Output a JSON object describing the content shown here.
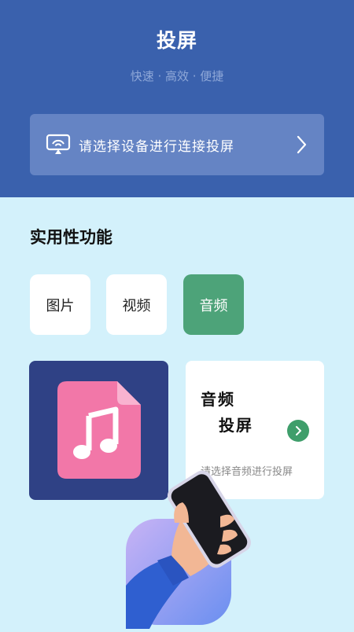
{
  "header": {
    "title": "投屏",
    "subtitle": "快速 · 高效 · 便捷",
    "connect_label": "请选择设备进行连接投屏"
  },
  "features": {
    "section_title": "实用性功能",
    "tabs": [
      {
        "label": "图片",
        "active": false
      },
      {
        "label": "视频",
        "active": false
      },
      {
        "label": "音频",
        "active": true
      }
    ]
  },
  "audio_card": {
    "title_line1": "音频",
    "title_line2": "投屏",
    "description": "请选择音频进行投屏"
  },
  "icons": [
    "cast-icon",
    "chevron-right-icon",
    "music-file-icon",
    "arrow-right-icon",
    "hand-phone-illustration"
  ],
  "colors": {
    "header_bg": "#3a61ad",
    "page_bg": "#d3f1fb",
    "active_tab": "#4da379",
    "card_dark": "#2f4185",
    "file_pink": "#f277a8"
  }
}
